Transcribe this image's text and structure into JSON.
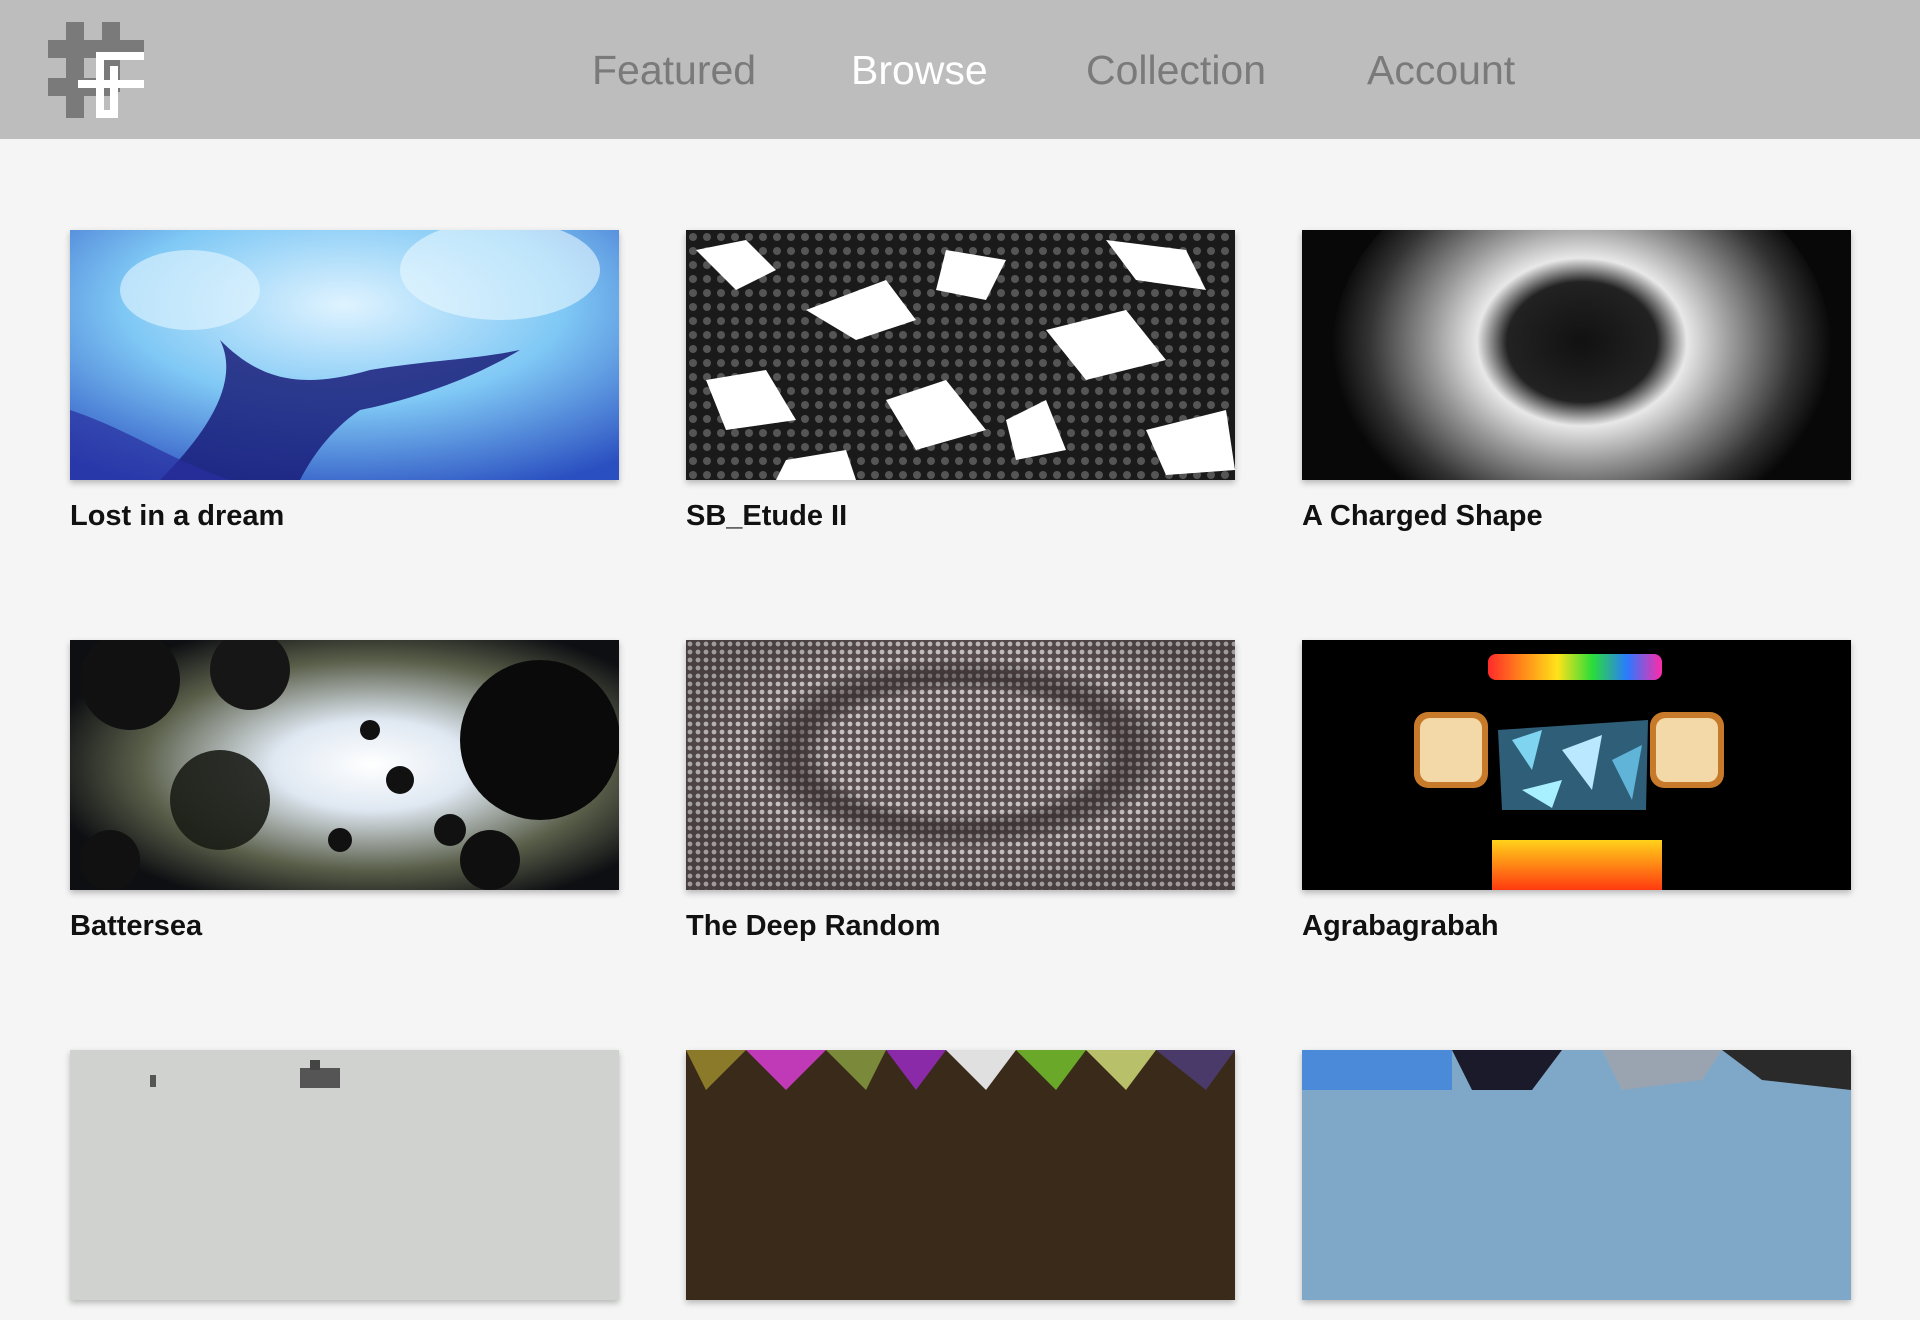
{
  "nav": {
    "items": [
      {
        "label": "Featured",
        "active": false
      },
      {
        "label": "Browse",
        "active": true
      },
      {
        "label": "Collection",
        "active": false
      },
      {
        "label": "Account",
        "active": false
      }
    ]
  },
  "logo": {
    "icon": "hash-cross-logo-icon",
    "color": "#7a7a7a",
    "accent": "#ffffff"
  },
  "colors": {
    "header_bg": "#bdbdbd",
    "page_bg": "#f5f5f5",
    "nav_inactive": "#7a7a7a",
    "nav_active": "#ffffff"
  },
  "grid": {
    "items": [
      {
        "title": "Lost in a dream"
      },
      {
        "title": "SB_Etude II"
      },
      {
        "title": "A Charged Shape"
      },
      {
        "title": "Battersea"
      },
      {
        "title": "The Deep Random"
      },
      {
        "title": "Agrabagrabah"
      },
      {
        "title": ""
      },
      {
        "title": ""
      },
      {
        "title": ""
      }
    ]
  }
}
